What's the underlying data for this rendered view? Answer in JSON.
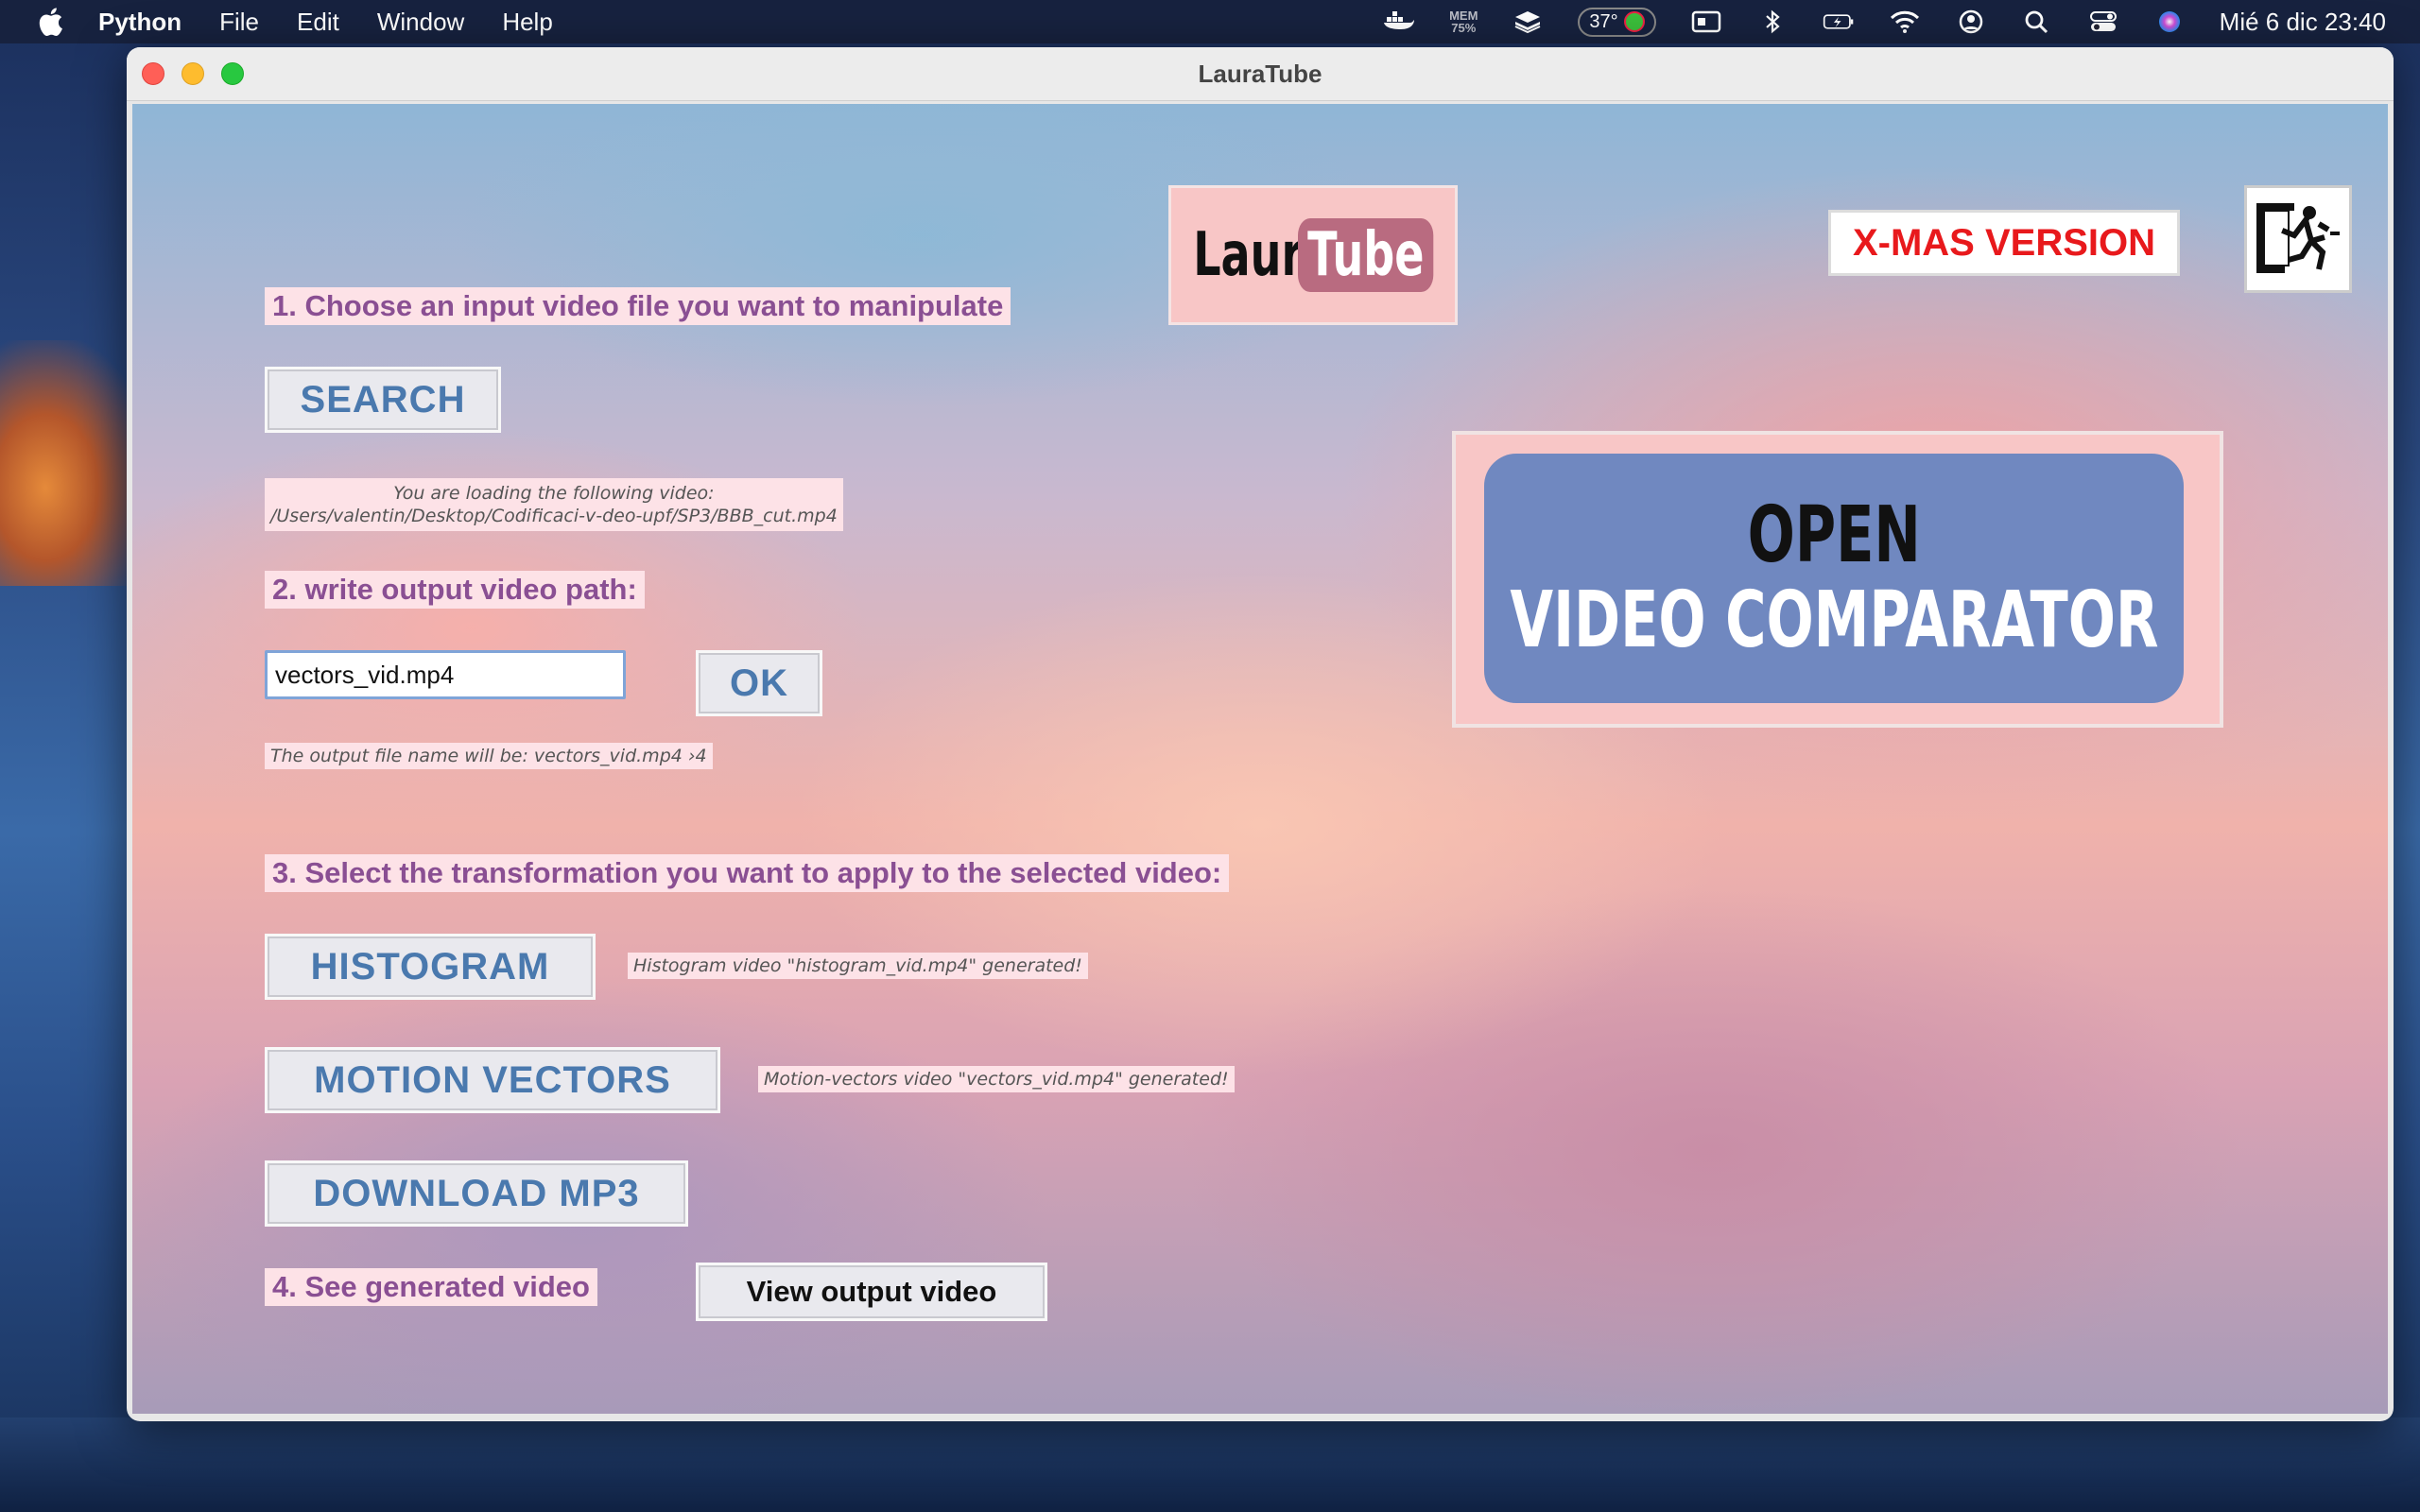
{
  "menubar": {
    "app_name": "Python",
    "menus": [
      "File",
      "Edit",
      "Window",
      "Help"
    ],
    "mem_label": "MEM",
    "mem_value": "75%",
    "temperature": "37°",
    "clock": "Mié 6 dic  23:40"
  },
  "window": {
    "title": "LauraTube"
  },
  "logo": {
    "part1": "Laura",
    "part2": "Tube"
  },
  "xmas_label": "X-MAS VERSION",
  "steps": {
    "step1": "1. Choose an input video file you want to manipulate",
    "step2": "2. write output video path:",
    "step3": "3. Select the transformation you want to apply to the selected video:",
    "step4": "4. See generated video"
  },
  "buttons": {
    "search": "SEARCH",
    "ok": "OK",
    "histogram": "HISTOGRAM",
    "motion_vectors": "MOTION VECTORS",
    "download_mp3": "DOWNLOAD MP3",
    "view_output": "View output video"
  },
  "loading": {
    "line1": "You are loading the following video:",
    "line2": "/Users/valentin/Desktop/Codificaci-v-deo-upf/SP3/BBB_cut.mp4"
  },
  "output_input_value": "vectors_vid.mp4",
  "output_name_msg": "The output file name will be: vectors_vid.mp4 ›4",
  "histogram_msg": "Histogram video \"histogram_vid.mp4\" generated!",
  "vectors_msg": "Motion-vectors video \"vectors_vid.mp4\" generated!",
  "comparator": {
    "line1": "OPEN",
    "line2": "VIDEO COMPARATOR"
  },
  "colors": {
    "label_bg": "#fde2e7",
    "label_text": "#8a4f93",
    "button_text": "#4a79ae",
    "comparator_bg": "#7088c0",
    "xmas_red": "#e8191c"
  }
}
